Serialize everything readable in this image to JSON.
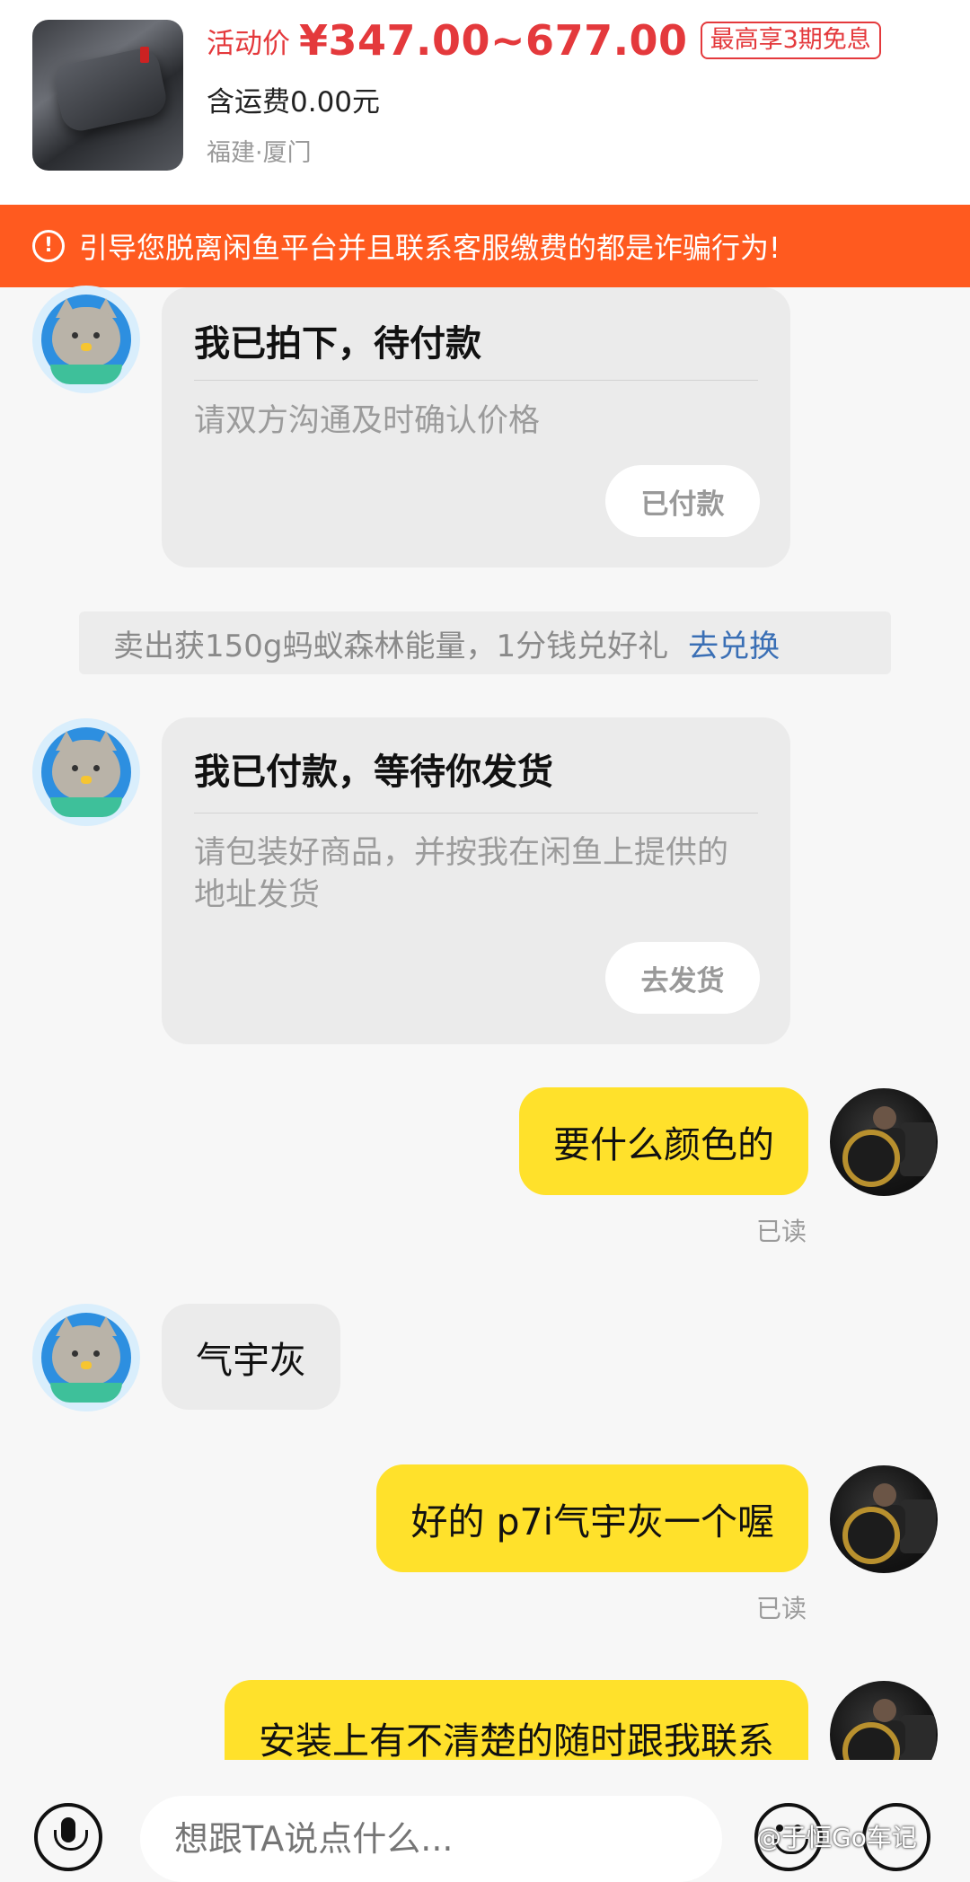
{
  "product": {
    "price_label": "活动价",
    "price_range": "¥347.00~677.00",
    "installment_badge": "最高享3期免息",
    "shipping": "含运费0.00元",
    "location": "福建·厦门"
  },
  "warning": {
    "icon": "!",
    "text": "引导您脱离闲鱼平台并且联系客服缴费的都是诈骗行为!"
  },
  "cards": [
    {
      "title": "我已拍下，待付款",
      "description": "请双方沟通及时确认价格",
      "button": "已付款"
    },
    {
      "title": "我已付款，等待你发货",
      "description": "请包装好商品，并按我在闲鱼上提供的地址发货",
      "button": "去发货"
    }
  ],
  "promo": {
    "text": "卖出获150g蚂蚁森林能量，1分钱兑好礼",
    "link": "去兑换"
  },
  "messages": [
    {
      "from": "me",
      "text": "要什么颜色的",
      "status": "已读"
    },
    {
      "from": "other",
      "text": "气宇灰"
    },
    {
      "from": "me",
      "text": "好的 p7i气宇灰一个喔",
      "status": "已读"
    },
    {
      "from": "me",
      "text": "安装上有不清楚的随时跟我联系"
    }
  ],
  "input": {
    "placeholder": "想跟TA说点什么..."
  },
  "watermark": "@于恒Go车记",
  "colors": {
    "accent_red": "#e4393c",
    "warning_bg": "#ff5a1f",
    "my_bubble": "#ffe12b",
    "link_blue": "#3a6fb5"
  }
}
